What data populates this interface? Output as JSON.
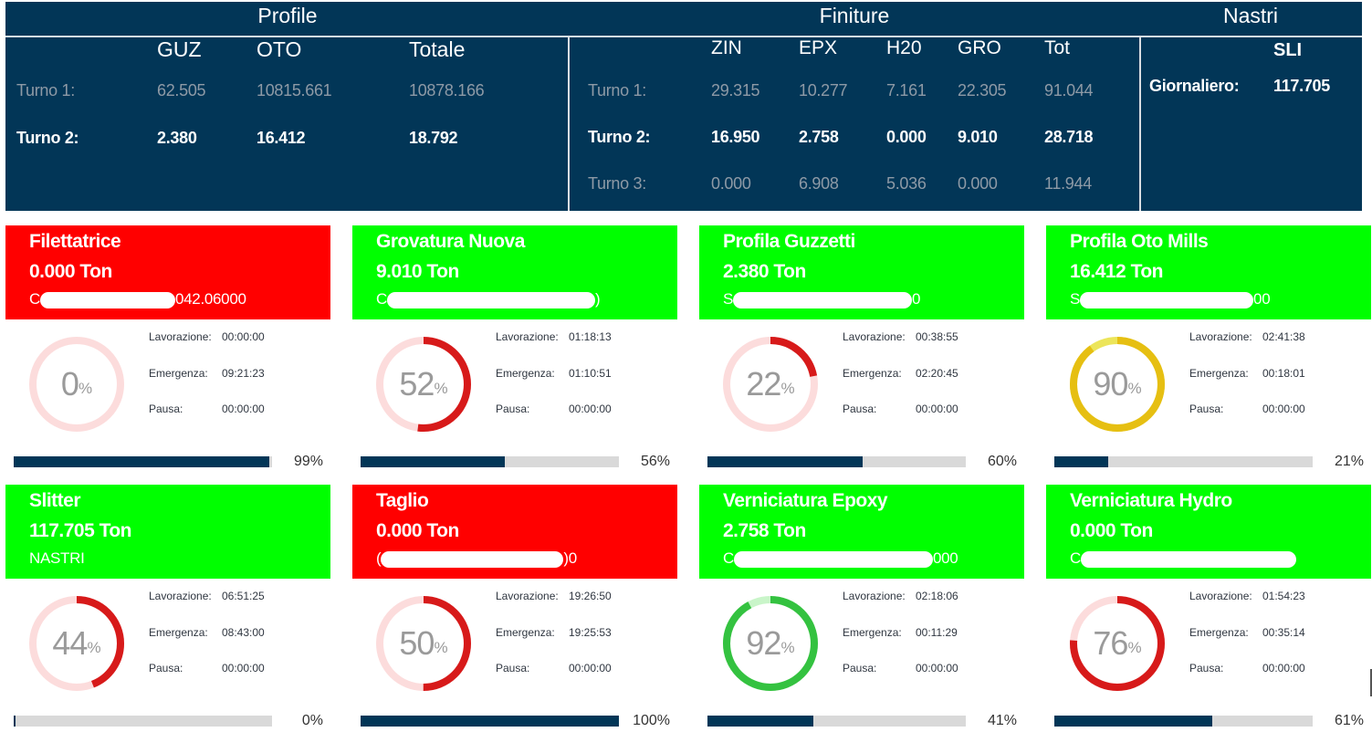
{
  "summary": {
    "profile": {
      "title": "Profile",
      "columns": [
        "GUZ",
        "OTO",
        "Totale"
      ],
      "rows": [
        {
          "label": "Turno 1:",
          "values": [
            "62.505",
            "10815.661",
            "10878.166"
          ],
          "active": false
        },
        {
          "label": "Turno 2:",
          "values": [
            "2.380",
            "16.412",
            "18.792"
          ],
          "active": true
        }
      ]
    },
    "finiture": {
      "title": "Finiture",
      "columns": [
        "ZIN",
        "EPX",
        "H20",
        "GRO",
        "Tot"
      ],
      "rows": [
        {
          "label": "Turno 1:",
          "values": [
            "29.315",
            "10.277",
            "7.161",
            "22.305",
            "91.044"
          ],
          "active": false
        },
        {
          "label": "Turno 2:",
          "values": [
            "16.950",
            "2.758",
            "0.000",
            "9.010",
            "28.718"
          ],
          "active": true
        },
        {
          "label": "Turno 3:",
          "values": [
            "0.000",
            "6.908",
            "5.036",
            "0.000",
            "11.944"
          ],
          "active": false
        }
      ]
    },
    "nastri": {
      "title": "Nastri",
      "column": "SLI",
      "label": "Giornaliero:",
      "value": "117.705"
    }
  },
  "stat_labels": {
    "lavorazione": "Lavorazione:",
    "emergenza": "Emergenza:",
    "pausa": "Pausa:"
  },
  "colors": {
    "navy": "#023657",
    "status_red": "#ff0000",
    "status_green": "#00ff00",
    "gauge_red": "#d71a1a",
    "gauge_red_track": "#fcdcdc",
    "gauge_yellow": "#e6bf12",
    "gauge_yellow_track": "#ece55a",
    "gauge_green": "#34c240",
    "gauge_green_track": "#c9f5c9"
  },
  "machines": [
    {
      "name": "Filettatrice",
      "ton": "0.000 Ton",
      "status": "red",
      "code_prefix": "C",
      "code_suffix": "042.06000",
      "gauge_percent": 0,
      "gauge_color": "red",
      "lavorazione": "00:00:00",
      "emergenza": "09:21:23",
      "pausa": "00:00:00",
      "progress_percent": 99
    },
    {
      "name": "Grovatura Nuova",
      "ton": "9.010 Ton",
      "status": "green",
      "code_prefix": "C",
      "code_suffix": ")",
      "gauge_percent": 52,
      "gauge_color": "red",
      "lavorazione": "01:18:13",
      "emergenza": "01:10:51",
      "pausa": "00:00:00",
      "progress_percent": 56
    },
    {
      "name": "Profila Guzzetti",
      "ton": "2.380 Ton",
      "status": "green",
      "code_prefix": "S",
      "code_suffix": "0",
      "gauge_percent": 22,
      "gauge_color": "red",
      "lavorazione": "00:38:55",
      "emergenza": "02:20:45",
      "pausa": "00:00:00",
      "progress_percent": 60
    },
    {
      "name": "Profila Oto Mills",
      "ton": "16.412 Ton",
      "status": "green",
      "code_prefix": "S",
      "code_suffix": "00",
      "gauge_percent": 90,
      "gauge_color": "yellow",
      "lavorazione": "02:41:38",
      "emergenza": "00:18:01",
      "pausa": "00:00:00",
      "progress_percent": 21
    },
    {
      "name": "Slitter",
      "ton": "117.705 Ton",
      "status": "green",
      "code_prefix": "NASTRI",
      "code_suffix": "",
      "gauge_percent": 44,
      "gauge_color": "red",
      "lavorazione": "06:51:25",
      "emergenza": "08:43:00",
      "pausa": "00:00:00",
      "progress_percent": 0
    },
    {
      "name": "Taglio",
      "ton": "0.000 Ton",
      "status": "red",
      "code_prefix": "(",
      "code_suffix": ")0",
      "gauge_percent": 50,
      "gauge_color": "red",
      "lavorazione": "19:26:50",
      "emergenza": "19:25:53",
      "pausa": "00:00:00",
      "progress_percent": 100
    },
    {
      "name": "Verniciatura Epoxy",
      "ton": "2.758 Ton",
      "status": "green",
      "code_prefix": "C",
      "code_suffix": "000",
      "gauge_percent": 92,
      "gauge_color": "green",
      "lavorazione": "02:18:06",
      "emergenza": "00:11:29",
      "pausa": "00:00:00",
      "progress_percent": 41
    },
    {
      "name": "Verniciatura Hydro",
      "ton": "0.000 Ton",
      "status": "green",
      "code_prefix": "C",
      "code_suffix": "",
      "gauge_percent": 76,
      "gauge_color": "red",
      "lavorazione": "01:54:23",
      "emergenza": "00:35:14",
      "pausa": "00:00:00",
      "progress_percent": 61
    }
  ]
}
